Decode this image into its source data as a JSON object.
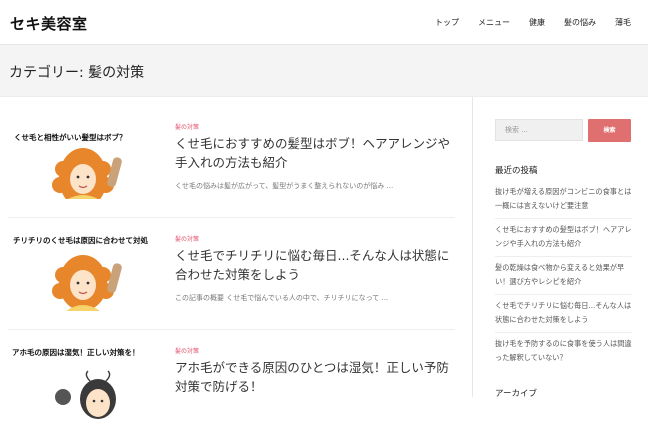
{
  "site": {
    "title": "セキ美容室"
  },
  "nav": {
    "items": [
      "トップ",
      "メニュー",
      "健康",
      "髪の悩み",
      "薄毛"
    ]
  },
  "category": {
    "heading": "カテゴリー: 髪の対策"
  },
  "posts": [
    {
      "thumb_caption": "くせ毛と相性がいい髪型はボブ？",
      "category": "髪の対策",
      "title": "くせ毛におすすめの髪型はボブ！ヘアアレンジや手入れの方法も紹介",
      "excerpt": "くせ毛の悩みは髪が広がって、髪型がうまく整えられないのが悩み ..."
    },
    {
      "thumb_caption": "チリチリのくせ毛は原因に合わせて対処",
      "category": "髪の対策",
      "title": "くせ毛でチリチリに悩む毎日...そんな人は状態に合わせた対策をしよう",
      "excerpt": "この記事の概要 くせ毛で悩んでいる人の中で、チリチリになって ..."
    },
    {
      "thumb_caption": "アホ毛の原因は湿気！正しい対策を！",
      "category": "髪の対策",
      "title": "アホ毛ができる原因のひとつは湿気！正しい予防対策で防げる！",
      "excerpt": ""
    }
  ],
  "sidebar": {
    "search_placeholder": "検索 ...",
    "search_button": "検索",
    "recent_title": "最近の投稿",
    "recent_posts": [
      "抜け毛が増える原因がコンビニの食事とは一概には言えないけど要注意",
      "くせ毛におすすめの髪型はボブ！ヘアアレンジや手入れの方法も紹介",
      "髪の乾燥は食べ物から変えると効果が早い！選び方やレシピを紹介",
      "くせ毛でチリチリに悩む毎日...そんな人は状態に合わせた対策をしよう",
      "抜け毛を予防するのに食事を使う人は間違った解釈していない？"
    ],
    "archive_title": "アーカイブ"
  },
  "colors": {
    "accent": "#e06f6f",
    "category_label": "#e0506a",
    "hair": "#e8862c"
  }
}
